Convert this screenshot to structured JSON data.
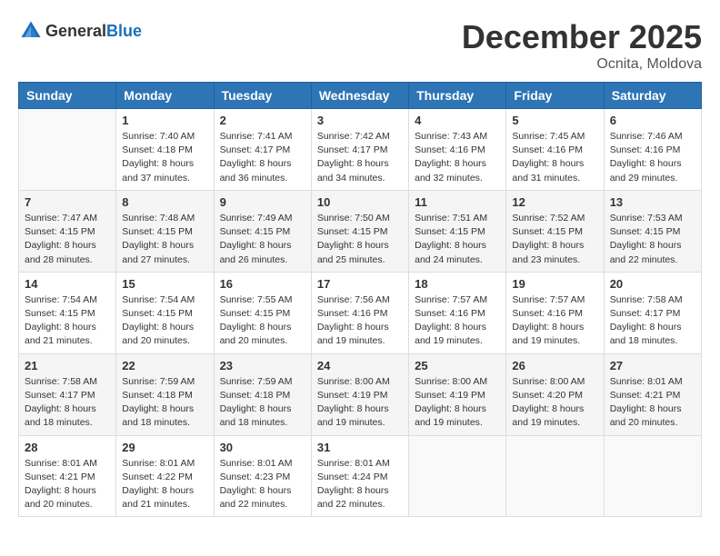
{
  "header": {
    "logo_general": "General",
    "logo_blue": "Blue",
    "month_title": "December 2025",
    "location": "Ocnita, Moldova"
  },
  "weekdays": [
    "Sunday",
    "Monday",
    "Tuesday",
    "Wednesday",
    "Thursday",
    "Friday",
    "Saturday"
  ],
  "weeks": [
    [
      {
        "day": "",
        "sunrise": "",
        "sunset": "",
        "daylight": ""
      },
      {
        "day": "1",
        "sunrise": "Sunrise: 7:40 AM",
        "sunset": "Sunset: 4:18 PM",
        "daylight": "Daylight: 8 hours and 37 minutes."
      },
      {
        "day": "2",
        "sunrise": "Sunrise: 7:41 AM",
        "sunset": "Sunset: 4:17 PM",
        "daylight": "Daylight: 8 hours and 36 minutes."
      },
      {
        "day": "3",
        "sunrise": "Sunrise: 7:42 AM",
        "sunset": "Sunset: 4:17 PM",
        "daylight": "Daylight: 8 hours and 34 minutes."
      },
      {
        "day": "4",
        "sunrise": "Sunrise: 7:43 AM",
        "sunset": "Sunset: 4:16 PM",
        "daylight": "Daylight: 8 hours and 32 minutes."
      },
      {
        "day": "5",
        "sunrise": "Sunrise: 7:45 AM",
        "sunset": "Sunset: 4:16 PM",
        "daylight": "Daylight: 8 hours and 31 minutes."
      },
      {
        "day": "6",
        "sunrise": "Sunrise: 7:46 AM",
        "sunset": "Sunset: 4:16 PM",
        "daylight": "Daylight: 8 hours and 29 minutes."
      }
    ],
    [
      {
        "day": "7",
        "sunrise": "Sunrise: 7:47 AM",
        "sunset": "Sunset: 4:15 PM",
        "daylight": "Daylight: 8 hours and 28 minutes."
      },
      {
        "day": "8",
        "sunrise": "Sunrise: 7:48 AM",
        "sunset": "Sunset: 4:15 PM",
        "daylight": "Daylight: 8 hours and 27 minutes."
      },
      {
        "day": "9",
        "sunrise": "Sunrise: 7:49 AM",
        "sunset": "Sunset: 4:15 PM",
        "daylight": "Daylight: 8 hours and 26 minutes."
      },
      {
        "day": "10",
        "sunrise": "Sunrise: 7:50 AM",
        "sunset": "Sunset: 4:15 PM",
        "daylight": "Daylight: 8 hours and 25 minutes."
      },
      {
        "day": "11",
        "sunrise": "Sunrise: 7:51 AM",
        "sunset": "Sunset: 4:15 PM",
        "daylight": "Daylight: 8 hours and 24 minutes."
      },
      {
        "day": "12",
        "sunrise": "Sunrise: 7:52 AM",
        "sunset": "Sunset: 4:15 PM",
        "daylight": "Daylight: 8 hours and 23 minutes."
      },
      {
        "day": "13",
        "sunrise": "Sunrise: 7:53 AM",
        "sunset": "Sunset: 4:15 PM",
        "daylight": "Daylight: 8 hours and 22 minutes."
      }
    ],
    [
      {
        "day": "14",
        "sunrise": "Sunrise: 7:54 AM",
        "sunset": "Sunset: 4:15 PM",
        "daylight": "Daylight: 8 hours and 21 minutes."
      },
      {
        "day": "15",
        "sunrise": "Sunrise: 7:54 AM",
        "sunset": "Sunset: 4:15 PM",
        "daylight": "Daylight: 8 hours and 20 minutes."
      },
      {
        "day": "16",
        "sunrise": "Sunrise: 7:55 AM",
        "sunset": "Sunset: 4:15 PM",
        "daylight": "Daylight: 8 hours and 20 minutes."
      },
      {
        "day": "17",
        "sunrise": "Sunrise: 7:56 AM",
        "sunset": "Sunset: 4:16 PM",
        "daylight": "Daylight: 8 hours and 19 minutes."
      },
      {
        "day": "18",
        "sunrise": "Sunrise: 7:57 AM",
        "sunset": "Sunset: 4:16 PM",
        "daylight": "Daylight: 8 hours and 19 minutes."
      },
      {
        "day": "19",
        "sunrise": "Sunrise: 7:57 AM",
        "sunset": "Sunset: 4:16 PM",
        "daylight": "Daylight: 8 hours and 19 minutes."
      },
      {
        "day": "20",
        "sunrise": "Sunrise: 7:58 AM",
        "sunset": "Sunset: 4:17 PM",
        "daylight": "Daylight: 8 hours and 18 minutes."
      }
    ],
    [
      {
        "day": "21",
        "sunrise": "Sunrise: 7:58 AM",
        "sunset": "Sunset: 4:17 PM",
        "daylight": "Daylight: 8 hours and 18 minutes."
      },
      {
        "day": "22",
        "sunrise": "Sunrise: 7:59 AM",
        "sunset": "Sunset: 4:18 PM",
        "daylight": "Daylight: 8 hours and 18 minutes."
      },
      {
        "day": "23",
        "sunrise": "Sunrise: 7:59 AM",
        "sunset": "Sunset: 4:18 PM",
        "daylight": "Daylight: 8 hours and 18 minutes."
      },
      {
        "day": "24",
        "sunrise": "Sunrise: 8:00 AM",
        "sunset": "Sunset: 4:19 PM",
        "daylight": "Daylight: 8 hours and 19 minutes."
      },
      {
        "day": "25",
        "sunrise": "Sunrise: 8:00 AM",
        "sunset": "Sunset: 4:19 PM",
        "daylight": "Daylight: 8 hours and 19 minutes."
      },
      {
        "day": "26",
        "sunrise": "Sunrise: 8:00 AM",
        "sunset": "Sunset: 4:20 PM",
        "daylight": "Daylight: 8 hours and 19 minutes."
      },
      {
        "day": "27",
        "sunrise": "Sunrise: 8:01 AM",
        "sunset": "Sunset: 4:21 PM",
        "daylight": "Daylight: 8 hours and 20 minutes."
      }
    ],
    [
      {
        "day": "28",
        "sunrise": "Sunrise: 8:01 AM",
        "sunset": "Sunset: 4:21 PM",
        "daylight": "Daylight: 8 hours and 20 minutes."
      },
      {
        "day": "29",
        "sunrise": "Sunrise: 8:01 AM",
        "sunset": "Sunset: 4:22 PM",
        "daylight": "Daylight: 8 hours and 21 minutes."
      },
      {
        "day": "30",
        "sunrise": "Sunrise: 8:01 AM",
        "sunset": "Sunset: 4:23 PM",
        "daylight": "Daylight: 8 hours and 22 minutes."
      },
      {
        "day": "31",
        "sunrise": "Sunrise: 8:01 AM",
        "sunset": "Sunset: 4:24 PM",
        "daylight": "Daylight: 8 hours and 22 minutes."
      },
      {
        "day": "",
        "sunrise": "",
        "sunset": "",
        "daylight": ""
      },
      {
        "day": "",
        "sunrise": "",
        "sunset": "",
        "daylight": ""
      },
      {
        "day": "",
        "sunrise": "",
        "sunset": "",
        "daylight": ""
      }
    ]
  ]
}
